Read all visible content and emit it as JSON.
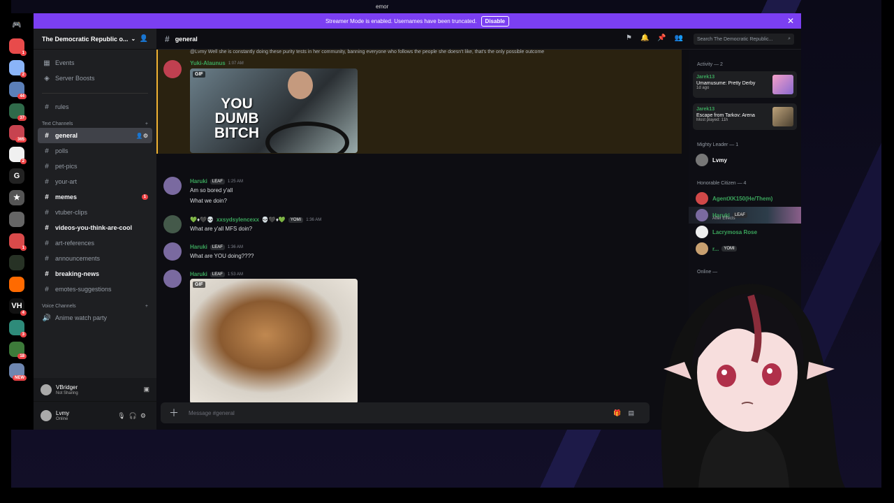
{
  "top_caption": "emor",
  "banner": {
    "text": "Streamer Mode is enabled. Usernames have been truncated.",
    "disable": "Disable",
    "close": "✕"
  },
  "rail": {
    "servers": [
      {
        "color": "#e84b4b",
        "badge": "1"
      },
      {
        "color": "#8ab4f8",
        "badge": "2"
      },
      {
        "color": "#5b7fb8",
        "badge": "44"
      },
      {
        "color": "#2f6a4a",
        "badge": "37"
      },
      {
        "color": "#c7434f",
        "badge": "365"
      },
      {
        "color": "#f0f0f0",
        "badge": "2"
      },
      {
        "color": "#222",
        "text": "G"
      },
      {
        "color": "#555",
        "text": "★"
      },
      {
        "color": "#666"
      },
      {
        "color": "#d84a4a",
        "badge": "1"
      },
      {
        "color": "#273225"
      },
      {
        "color": "#ff6a00"
      },
      {
        "color": "#111",
        "text": "VH",
        "badge": "4"
      },
      {
        "color": "#2e8b7a",
        "badge": "3"
      },
      {
        "color": "#3d7a3a",
        "badge": "18"
      },
      {
        "color": "#6e86b0",
        "badge": "NEW"
      }
    ]
  },
  "sidebar": {
    "server_name": "The Democratic Republic o...",
    "top_items": [
      {
        "label": "Events",
        "icon": "📅"
      },
      {
        "label": "Server Boosts",
        "icon": "◈"
      }
    ],
    "rules": "rules",
    "text_cat": "Text Channels",
    "channels": [
      {
        "label": "general",
        "active": true
      },
      {
        "label": "polls"
      },
      {
        "label": "pet-pics"
      },
      {
        "label": "your-art"
      },
      {
        "label": "memes",
        "bold": true,
        "badge": "1"
      },
      {
        "label": "vtuber-clips"
      },
      {
        "label": "videos-you-think-are-cool",
        "bold": true
      },
      {
        "label": "art-references"
      },
      {
        "label": "announcements"
      },
      {
        "label": "breaking-news",
        "bold": true
      },
      {
        "label": "emotes-suggestions"
      }
    ],
    "voice_cat": "Voice Channels",
    "voice": "Anime watch party"
  },
  "user_panel": {
    "app_name": "VBridger",
    "app_status": "Not Sharing",
    "user": "Lvmy",
    "status": "Online"
  },
  "channel": {
    "name": "general",
    "search_placeholder": "Search The Democratic Republic..."
  },
  "messages": {
    "reply": "@Lvmy Well she is constantly doing these purity tests in her community, banning everyone who follows the people she doesn't like, that's the only possible outcome",
    "m1": {
      "name": "Yuki-Alaunus",
      "time": "1:07 AM",
      "gif": "GIF",
      "gif_text": "YOU DUMB BITCH"
    },
    "m2": {
      "name": "Haruki",
      "tag": "LEAF",
      "time": "1:25 AM",
      "l1": "Am so bored y'all",
      "l2": "What we doin?"
    },
    "m3": {
      "name": "xxsydsylencexx",
      "prefix": "💚♦🖤💀",
      "suffix": "💀🖤♦💚",
      "tag": "YOMI",
      "time": "1:36 AM",
      "l1": "What are y'all MFS doin?"
    },
    "m4": {
      "name": "Haruki",
      "tag": "LEAF",
      "time": "1:36 AM",
      "l1": "What are YOU doing????"
    },
    "m5": {
      "name": "Haruki",
      "tag": "LEAF",
      "time": "1:53 AM",
      "gif": "GIF"
    }
  },
  "composer": {
    "placeholder": "Message #general"
  },
  "members": {
    "activity_head": "Activity — 2",
    "activities": [
      {
        "name": "Jarek13",
        "game": "Umamusume: Pretty Derby",
        "sub": "1d ago"
      },
      {
        "name": "Jarek13",
        "game": "Escape from Tarkov: Arena",
        "sub": "Most played: 11h"
      }
    ],
    "leader_head": "Mighty Leader — 1",
    "leader": "Lvmy",
    "citizen_head": "Honorable Citizen — 4",
    "citizens": [
      {
        "name": "AgentXK150(He/Them)"
      },
      {
        "name": "Haruki",
        "tag": "LEAF",
        "sub": "After Effects"
      },
      {
        "name": "Lacrymosa Rose"
      },
      {
        "name": "r...",
        "tag": "YOMI"
      }
    ],
    "online_head": "Online — "
  }
}
